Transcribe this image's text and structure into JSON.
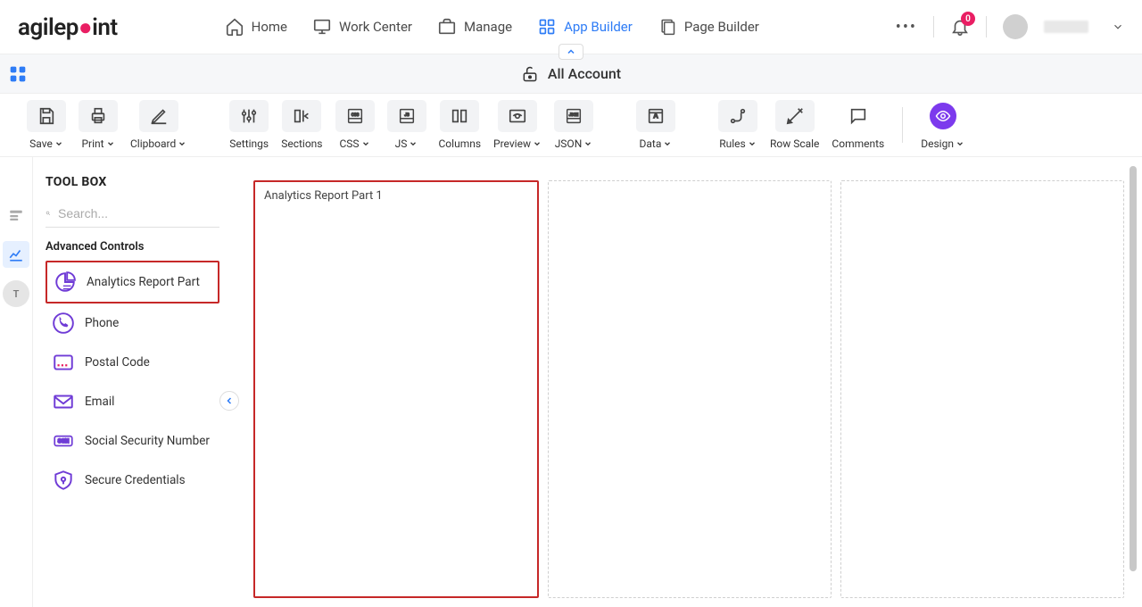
{
  "nav": {
    "logo_pre": "agilep",
    "logo_post": "int",
    "items": [
      {
        "label": "Home"
      },
      {
        "label": "Work Center"
      },
      {
        "label": "Manage"
      },
      {
        "label": "App Builder"
      },
      {
        "label": "Page Builder"
      }
    ],
    "notification_count": "0"
  },
  "page": {
    "title": "All Account"
  },
  "toolbar": {
    "save": "Save",
    "print": "Print",
    "clipboard": "Clipboard",
    "settings": "Settings",
    "sections": "Sections",
    "css": "CSS",
    "js": "JS",
    "columns": "Columns",
    "preview": "Preview",
    "json": "JSON",
    "data": "Data",
    "rules": "Rules",
    "rowscale": "Row Scale",
    "comments": "Comments",
    "design": "Design"
  },
  "sidebar": {
    "title": "TOOL BOX",
    "search_placeholder": "Search...",
    "section": "Advanced Controls",
    "controls": [
      {
        "label": "Analytics Report Part"
      },
      {
        "label": "Phone"
      },
      {
        "label": "Postal Code"
      },
      {
        "label": "Email"
      },
      {
        "label": "Social Security Number"
      },
      {
        "label": "Secure Credentials"
      }
    ]
  },
  "canvas": {
    "cell1": "Analytics Report Part 1"
  }
}
